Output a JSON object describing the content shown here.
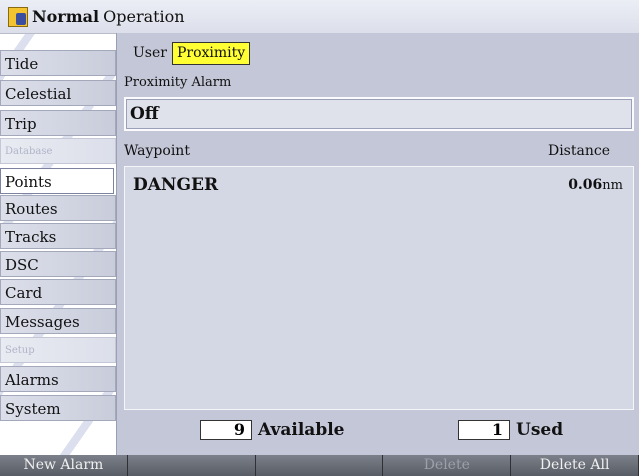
{
  "titlebar": {
    "title_bold": "Normal",
    "title_rest": "Operation"
  },
  "nav": {
    "items": [
      {
        "label": "Tide"
      },
      {
        "label": "Celestial"
      },
      {
        "label": "Trip"
      },
      {
        "label": "Database"
      },
      {
        "label": "Points"
      },
      {
        "label": "Routes"
      },
      {
        "label": "Tracks"
      },
      {
        "label": "DSC"
      },
      {
        "label": "Card"
      },
      {
        "label": "Messages"
      },
      {
        "label": "Setup"
      },
      {
        "label": "Alarms"
      },
      {
        "label": "System"
      }
    ],
    "active": "Points"
  },
  "tabs": [
    {
      "label": "User"
    },
    {
      "label": "Proximity"
    }
  ],
  "proximity_alarm": {
    "label": "Proximity Alarm",
    "value": "Off"
  },
  "list": {
    "header_waypoint": "Waypoint",
    "header_distance": "Distance",
    "rows": [
      {
        "waypoint": "DANGER",
        "distance": "0.06",
        "unit": "nm"
      }
    ]
  },
  "counters": {
    "available_count": "9",
    "available_label": "Available",
    "used_count": "1",
    "used_label": "Used"
  },
  "softkeys": [
    {
      "label": "New Alarm"
    },
    {
      "label": ""
    },
    {
      "label": ""
    },
    {
      "label": "Delete"
    },
    {
      "label": "Delete All"
    }
  ],
  "colors": {
    "tab_selected": "#ffff33",
    "panel": "#c4c7d7"
  }
}
